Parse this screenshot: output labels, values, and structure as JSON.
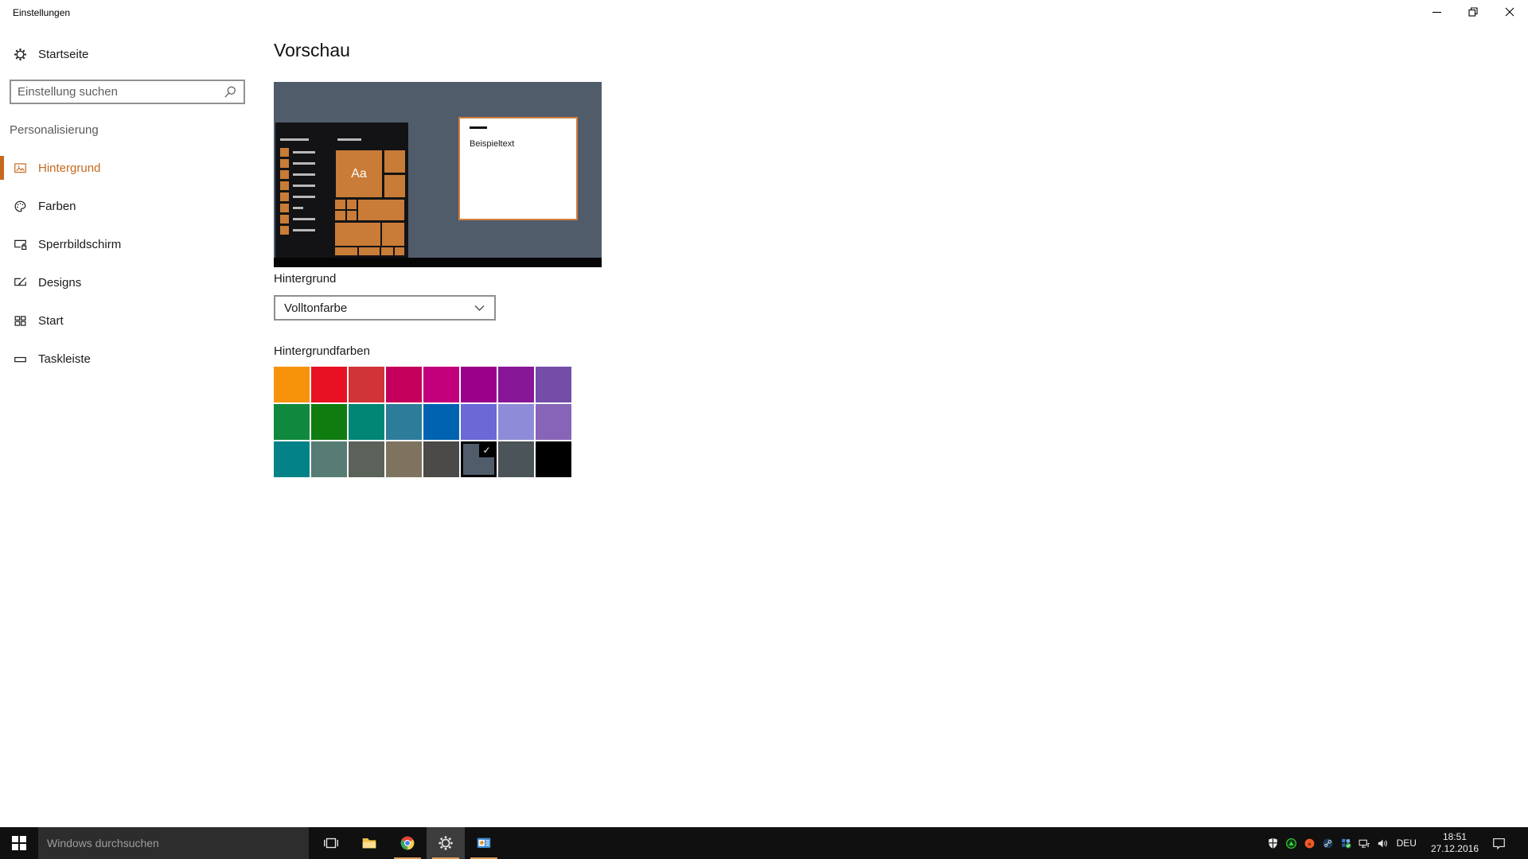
{
  "colors": {
    "accent": "#c5691e",
    "running_underline": "#e09a5c",
    "preview_background": "#515c6b",
    "preview_tile": "#c87c37",
    "taskbar_background": "#101010",
    "taskbar_search_background": "#2d2d2d"
  },
  "titlebar": {
    "title": "Einstellungen",
    "controls": [
      "minimize",
      "restore",
      "close"
    ]
  },
  "sidebar": {
    "home": {
      "label": "Startseite",
      "icon": "gear-icon"
    },
    "search": {
      "placeholder": "Einstellung suchen",
      "icon": "search-icon"
    },
    "section_label": "Personalisierung",
    "items": [
      {
        "label": "Hintergrund",
        "icon": "picture-icon",
        "selected": true
      },
      {
        "label": "Farben",
        "icon": "palette-icon",
        "selected": false
      },
      {
        "label": "Sperrbildschirm",
        "icon": "lock-screen-icon",
        "selected": false
      },
      {
        "label": "Designs",
        "icon": "themes-icon",
        "selected": false
      },
      {
        "label": "Start",
        "icon": "start-layout-icon",
        "selected": false
      },
      {
        "label": "Taskleiste",
        "icon": "taskbar-icon",
        "selected": false
      }
    ]
  },
  "main": {
    "preview_title": "Vorschau",
    "preview": {
      "tile_text": "Aa",
      "window_text": "Beispieltext"
    },
    "background_section": {
      "label": "Hintergrund",
      "dropdown_value": "Volltonfarbe"
    },
    "colors_section": {
      "label": "Hintergrundfarben",
      "check_glyph": "✓",
      "selected_index": 21,
      "swatches": [
        "#f7930a",
        "#e81123",
        "#d13438",
        "#c4005c",
        "#c2007c",
        "#9a0089",
        "#881798",
        "#744da9",
        "#10893e",
        "#107c10",
        "#018574",
        "#2d7d9a",
        "#0063b1",
        "#6b69d6",
        "#8e8cd8",
        "#8764b8",
        "#038387",
        "#567c73",
        "#5a625a",
        "#7e735f",
        "#4c4a48",
        "#515c6b",
        "#4a5459",
        "#000000"
      ]
    }
  },
  "taskbar": {
    "search_placeholder": "Windows durchsuchen",
    "app_icons": [
      "task-view-icon",
      "file-explorer-icon",
      "chrome-icon",
      "settings-gear-icon",
      "presentation-app-icon"
    ],
    "tray_icons": [
      "defender-shield-icon",
      "green-circle-tray-icon",
      "origin-tray-icon",
      "steam-tray-icon",
      "squares-check-tray-icon",
      "network-icon",
      "volume-icon"
    ],
    "language": "DEU",
    "clock": {
      "time": "18:51",
      "date": "27.12.2016"
    }
  }
}
